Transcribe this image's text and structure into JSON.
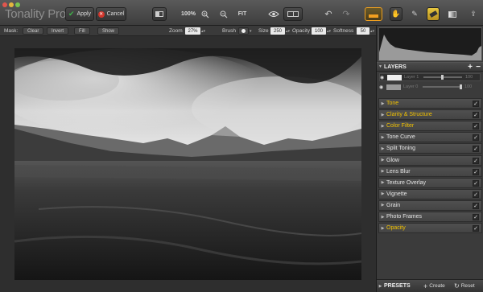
{
  "app": {
    "title": "Tonality Pro"
  },
  "toolbar": {
    "apply_label": "Apply",
    "cancel_label": "Cancel",
    "zoom_level": "100%",
    "fit_label": "FIT"
  },
  "optionbar": {
    "mask_label": "Mask:",
    "clear_label": "Clear",
    "invert_label": "Invert",
    "fill_label": "Fill",
    "show_label": "Show",
    "zoom_label": "Zoom",
    "zoom_value": "27%",
    "brush_label": "Brush",
    "size_label": "Size",
    "size_value": "250",
    "opacity_label": "Opacity",
    "opacity_value": "100",
    "softness_label": "Softness",
    "softness_value": "50"
  },
  "layers": {
    "title": "LAYERS",
    "items": [
      {
        "name": "Layer 1",
        "opacity": "100",
        "selected": true,
        "slider": 0.5
      },
      {
        "name": "Layer 0",
        "opacity": "100",
        "selected": false,
        "slider": 1.0
      }
    ]
  },
  "filters": [
    {
      "label": "Tone",
      "active": true
    },
    {
      "label": "Clarity & Structure",
      "active": true
    },
    {
      "label": "Color Filter",
      "active": true
    },
    {
      "label": "Tone Curve",
      "active": false
    },
    {
      "label": "Split Toning",
      "active": false
    },
    {
      "label": "Glow",
      "active": false
    },
    {
      "label": "Lens Blur",
      "active": false
    },
    {
      "label": "Texture Overlay",
      "active": false
    },
    {
      "label": "Vignette",
      "active": false
    },
    {
      "label": "Grain",
      "active": false
    },
    {
      "label": "Photo Frames",
      "active": false
    },
    {
      "label": "Opacity",
      "active": true
    }
  ],
  "presets": {
    "title": "PRESETS",
    "create_label": "Create",
    "reset_label": "Reset"
  },
  "colors": {
    "active_filter": "#f2c200",
    "inactive_filter": "#e4e4e4",
    "apply_icon": "#3fb449",
    "cancel_icon": "#d0352b"
  }
}
